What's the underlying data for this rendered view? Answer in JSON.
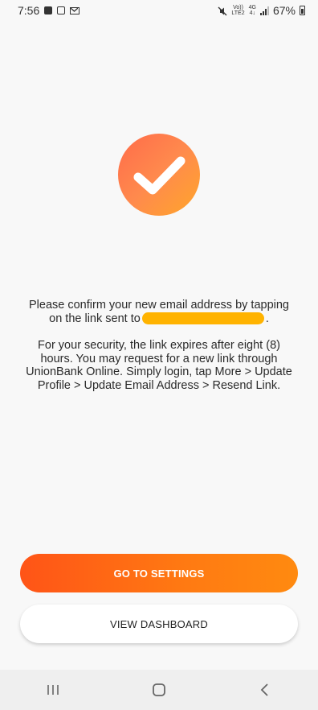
{
  "status_bar": {
    "time": "7:56",
    "volte_line1": "Vo))",
    "volte_line2": "LTE2",
    "network_line1": "4G",
    "network_line2": "4↓",
    "battery_percent": "67%",
    "icons": [
      "image-icon",
      "calendar-icon",
      "gmail-icon",
      "mute-icon",
      "signal-icon",
      "battery-icon"
    ]
  },
  "content": {
    "success_icon": "check-icon",
    "confirm_text_line1": "Please confirm your new email address by tapping",
    "confirm_text_prefix": "on the link sent to",
    "confirm_text_suffix": ".",
    "security_text": "For your security, the link expires after eight (8) hours. You may request for a new link through UnionBank Online. Simply login, tap More > Update Profile > Update Email Address > Resend Link."
  },
  "buttons": {
    "go_to_settings": "GO TO SETTINGS",
    "view_dashboard": "VIEW DASHBOARD"
  },
  "nav": {
    "recents": "recents-icon",
    "home": "home-icon",
    "back": "back-icon"
  },
  "colors": {
    "accent": "#ff6a14",
    "redaction": "#ffb300",
    "background": "#f8f8f8"
  }
}
